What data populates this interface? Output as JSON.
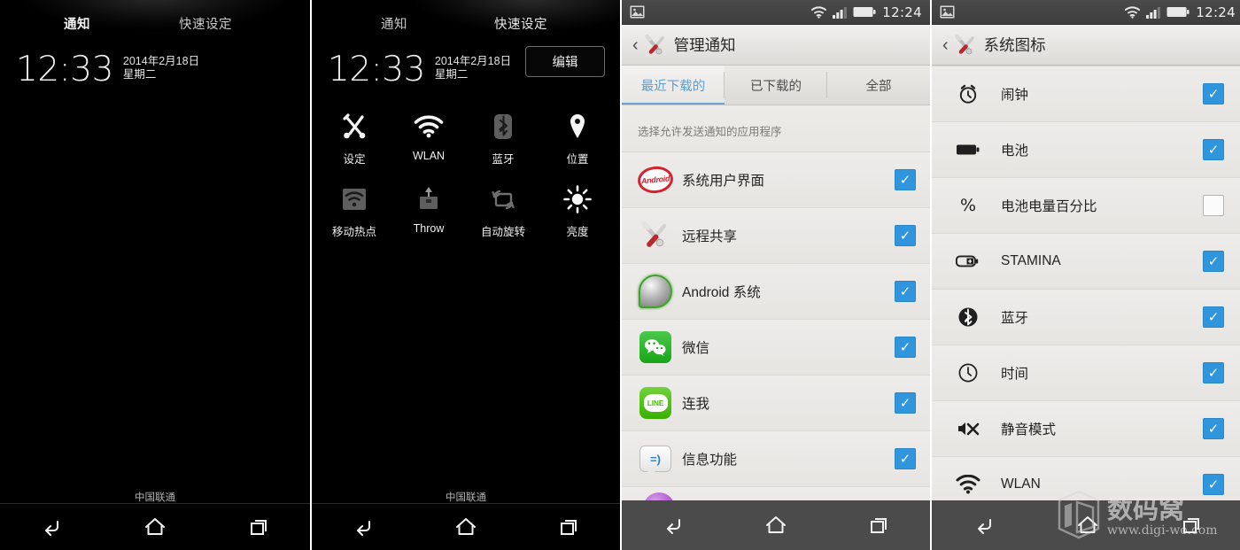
{
  "panel1": {
    "name": "notification-shade-collapsed",
    "tabs": [
      {
        "label": "通知",
        "active": true
      },
      {
        "label": "快速设定",
        "active": false
      }
    ],
    "clock": "12:33",
    "date": "2014年2月18日",
    "weekday": "星期二",
    "carrier": "中国联通",
    "nav": {
      "back": "back-icon",
      "home": "home-icon",
      "recents": "recents-icon"
    }
  },
  "panel2": {
    "name": "quick-settings-shade",
    "tabs": [
      {
        "label": "通知",
        "active": false
      },
      {
        "label": "快速设定",
        "active": true
      }
    ],
    "clock": "12:33",
    "date": "2014年2月18日",
    "weekday": "星期二",
    "edit_label": "编辑",
    "tiles": [
      {
        "label": "设定",
        "icon": "settings-wrench-icon",
        "enabled": true
      },
      {
        "label": "WLAN",
        "icon": "wifi-icon",
        "enabled": true
      },
      {
        "label": "蓝牙",
        "icon": "bluetooth-icon",
        "enabled": false
      },
      {
        "label": "位置",
        "icon": "location-pin-icon",
        "enabled": true
      },
      {
        "label": "移动热点",
        "icon": "hotspot-icon",
        "enabled": false
      },
      {
        "label": "Throw",
        "icon": "throw-cast-icon",
        "enabled": false
      },
      {
        "label": "自动旋转",
        "icon": "auto-rotate-icon",
        "enabled": false
      },
      {
        "label": "亮度",
        "icon": "brightness-sun-icon",
        "enabled": true
      }
    ],
    "carrier": "中国联通"
  },
  "panel3": {
    "name": "manage-notifications-screen",
    "statusbar": {
      "time": "12:24",
      "icons": [
        "image-icon",
        "wifi-icon",
        "signal-bars-icon",
        "battery-icon"
      ]
    },
    "actionbar": {
      "back": "back-chevron-icon",
      "app_icon": "settings-tools-icon",
      "title": "管理通知"
    },
    "tabs": [
      {
        "label": "最近下载的",
        "active": true
      },
      {
        "label": "已下载的",
        "active": false
      },
      {
        "label": "全部",
        "active": false
      }
    ],
    "hint": "选择允许发送通知的应用程序",
    "rows": [
      {
        "label": "系统用户界面",
        "icon": "android-kitkat-logo-icon",
        "checked": true
      },
      {
        "label": "远程共享",
        "icon": "tools-wrench-screwdriver-icon",
        "checked": true
      },
      {
        "label": "Android 系统",
        "icon": "android-system-icon",
        "checked": true
      },
      {
        "label": "微信",
        "icon": "wechat-icon",
        "checked": true
      },
      {
        "label": "连我",
        "icon": "line-icon",
        "checked": true
      },
      {
        "label": "信息功能",
        "icon": "messaging-icon",
        "checked": true
      }
    ],
    "partial_row_icon": "purple-app-icon"
  },
  "panel4": {
    "name": "system-icons-screen",
    "statusbar": {
      "time": "12:24",
      "icons": [
        "image-icon",
        "wifi-icon",
        "signal-bars-icon",
        "battery-icon"
      ]
    },
    "actionbar": {
      "back": "back-chevron-icon",
      "app_icon": "settings-tools-icon",
      "title": "系统图标"
    },
    "rows": [
      {
        "label": "闹钟",
        "icon": "alarm-clock-icon",
        "checked": true
      },
      {
        "label": "电池",
        "icon": "battery-icon",
        "checked": true
      },
      {
        "label": "电池电量百分比",
        "icon": "percent-icon",
        "checked": false
      },
      {
        "label": "STAMINA",
        "icon": "stamina-battery-icon",
        "checked": true
      },
      {
        "label": "蓝牙",
        "icon": "bluetooth-icon",
        "checked": true
      },
      {
        "label": "时间",
        "icon": "clock-icon",
        "checked": true
      },
      {
        "label": "静音模式",
        "icon": "mute-icon",
        "checked": true
      },
      {
        "label": "WLAN",
        "icon": "wifi-icon",
        "checked": true
      }
    ],
    "watermark": {
      "text": "数码窝",
      "url": "www.digi-wo.com"
    }
  },
  "colors": {
    "accent_blue": "#2f96de",
    "tab_active": "#5c9ed4",
    "shade_bg": "#000000",
    "settings_bg": "#ececea",
    "navbar_grey": "#4b4b4b"
  }
}
